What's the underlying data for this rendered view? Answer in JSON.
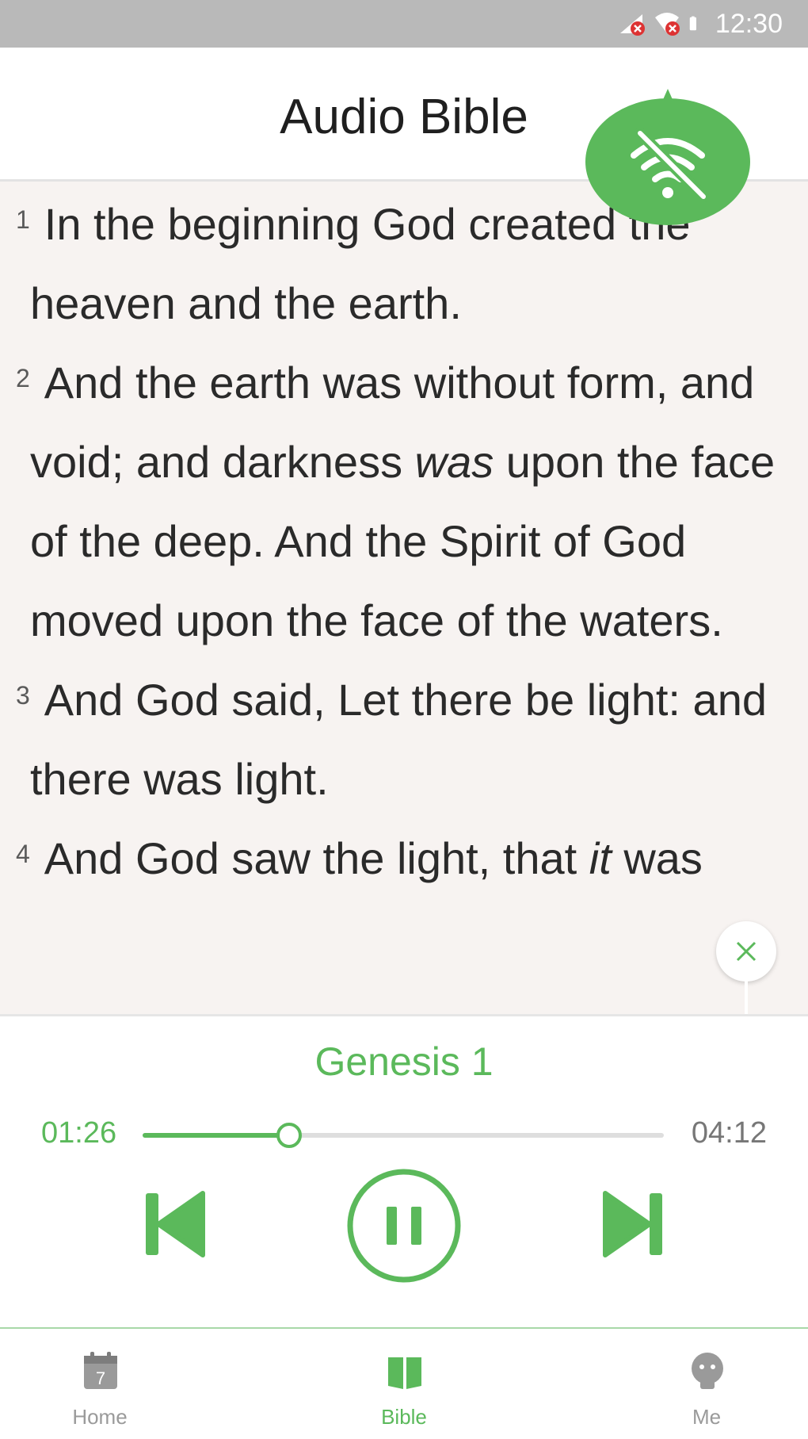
{
  "status_bar": {
    "time": "12:30",
    "icons": [
      "signal-blocked-icon",
      "wifi-blocked-icon",
      "battery-icon"
    ]
  },
  "header": {
    "title": "Audio Bible"
  },
  "offline_indicator": {
    "icon": "no-wifi-icon",
    "color": "#5bb95b"
  },
  "reading": {
    "verses": [
      {
        "num": "1",
        "text": "In the beginning God created the heaven and the earth."
      },
      {
        "num": "2",
        "text_before": "And the earth was without form, and void; and darkness ",
        "italic": "was",
        "text_after": " upon the face of the deep. And the Spirit of God moved upon the face of the waters."
      },
      {
        "num": "3",
        "text": "And God said, Let there be light: and there was light."
      },
      {
        "num": "4",
        "text_before": "And God saw the light, that ",
        "italic": "it",
        "text_after": " was"
      }
    ]
  },
  "player": {
    "chapter": "Genesis 1",
    "current_time": "01:26",
    "total_time": "04:12",
    "progress": 0.28,
    "controls": [
      "previous-icon",
      "pause-icon",
      "next-icon"
    ],
    "accent": "#5bb95b"
  },
  "bottom_nav": {
    "items": [
      {
        "label": "Home",
        "icon": "calendar-icon",
        "calendar_day": "7",
        "active": false
      },
      {
        "label": "Bible",
        "icon": "book-icon",
        "active": true
      },
      {
        "label": "Me",
        "icon": "person-icon",
        "active": false
      }
    ],
    "active_color": "#5bb95b",
    "inactive_color": "#9a9a9a"
  }
}
